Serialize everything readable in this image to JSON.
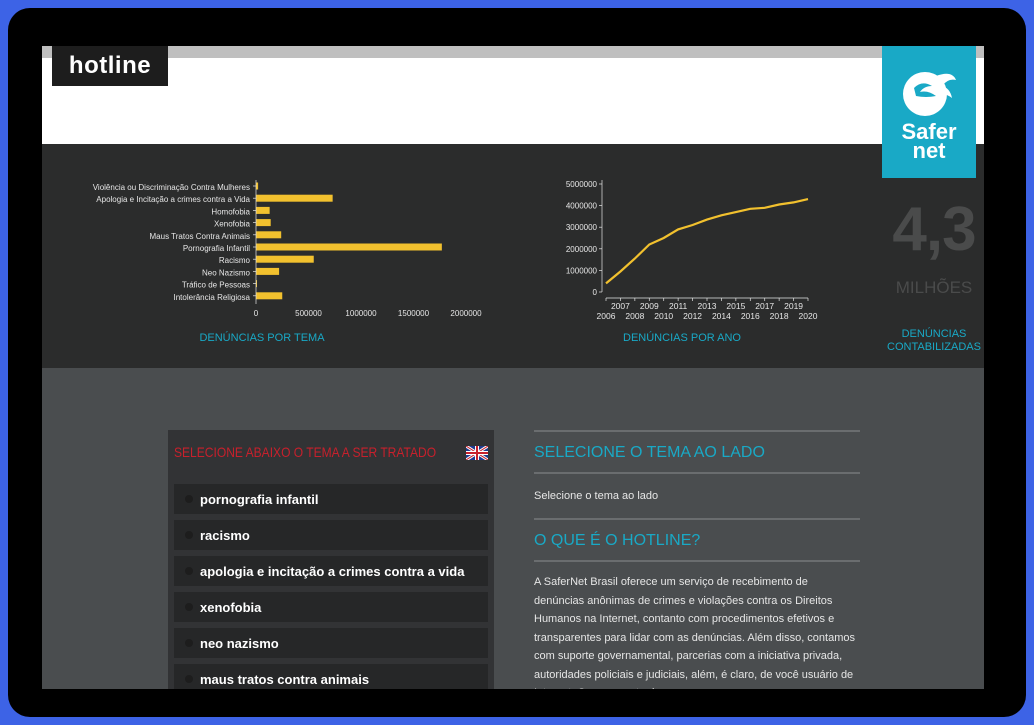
{
  "header": {
    "logo_text": "hotline",
    "brand_line1": "Safer",
    "brand_line2": "net"
  },
  "stats": {
    "big_number": "4,3",
    "big_unit": "MILHÕES",
    "big_caption_1": "DENÚNCIAS",
    "big_caption_2": "CONTABILIZADAS",
    "bar_caption": "DENÚNCIAS POR TEMA",
    "line_caption": "DENÚNCIAS POR ANO"
  },
  "chart_data": [
    {
      "type": "bar",
      "orientation": "horizontal",
      "categories": [
        "Violência ou Discriminação Contra Mulheres",
        "Apologia e Incitação a crimes contra a Vida",
        "Homofobia",
        "Xenofobia",
        "Maus Tratos Contra Animais",
        "Pornografia Infantil",
        "Racismo",
        "Neo Nazismo",
        "Tráfico de Pessoas",
        "Intolerância Religiosa"
      ],
      "values": [
        20000,
        730000,
        130000,
        140000,
        240000,
        1770000,
        550000,
        220000,
        8000,
        250000
      ],
      "x_ticks": [
        "0",
        "500000",
        "1000000",
        "1500000",
        "2000000"
      ],
      "xlim": [
        0,
        2000000
      ],
      "color": "#f2c12e"
    },
    {
      "type": "line",
      "x": [
        2006,
        2007,
        2008,
        2009,
        2010,
        2011,
        2012,
        2013,
        2014,
        2015,
        2016,
        2017,
        2018,
        2019,
        2020
      ],
      "values": [
        400000,
        950000,
        1550000,
        2200000,
        2500000,
        2900000,
        3100000,
        3350000,
        3550000,
        3700000,
        3850000,
        3900000,
        4050000,
        4150000,
        4300000
      ],
      "x_ticks_top": [
        "2007",
        "2009",
        "2011",
        "2013",
        "2015",
        "2017",
        "2019"
      ],
      "x_ticks_bottom": [
        "2006",
        "2008",
        "2010",
        "2012",
        "2014",
        "2016",
        "2018",
        "2020"
      ],
      "y_ticks": [
        "0",
        "1000000",
        "2000000",
        "3000000",
        "4000000",
        "5000000"
      ],
      "ylim": [
        0,
        5000000
      ],
      "color": "#f2c12e"
    }
  ],
  "panel": {
    "title": "SELECIONE ABAIXO O TEMA A SER TRATADO",
    "topics": [
      "pornografia infantil",
      "racismo",
      "apologia e incitação a crimes contra a vida",
      "xenofobia",
      "neo nazismo",
      "maus tratos contra animais"
    ]
  },
  "right": {
    "select_heading": "SELECIONE O TEMA AO LADO",
    "select_text": "Selecione o tema ao lado",
    "about_heading": "O QUE É O HOTLINE?",
    "about_text": "A SaferNet Brasil oferece um serviço de recebimento de denúncias anônimas de crimes e violações contra os Direitos Humanos na Internet, contanto com procedimentos efetivos e transparentes para lidar com as denúncias. Além disso, contamos com suporte governamental, parcerias com a iniciativa privada, autoridades policiais e judiciais, além, é claro, de você usuário de Internet. Caso encontre imagens"
  },
  "colors": {
    "accent": "#19a9c6",
    "bar": "#f2c12e",
    "panel_title": "#c8202c"
  }
}
